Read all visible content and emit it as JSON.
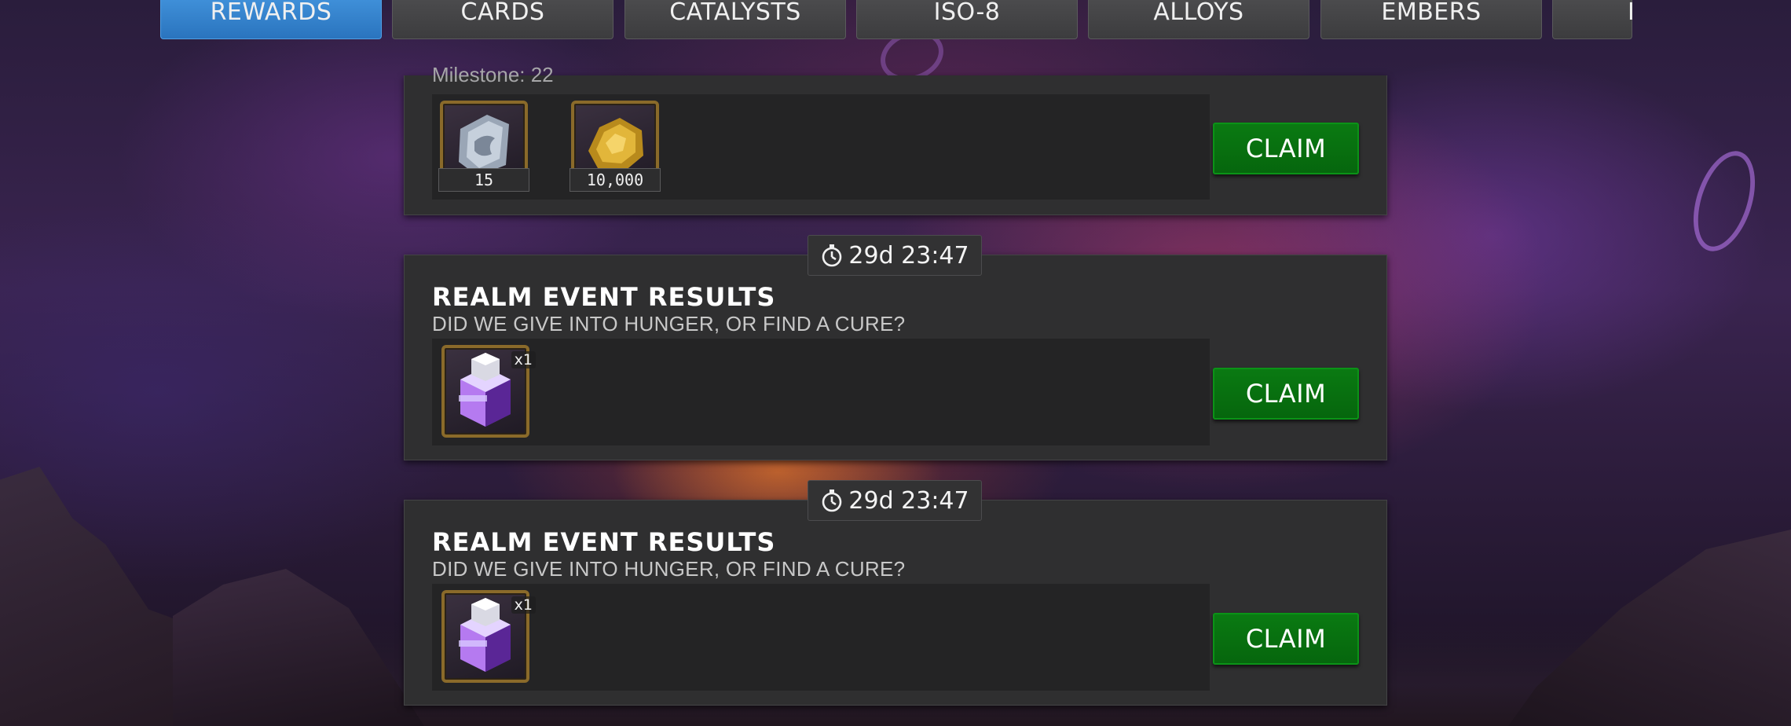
{
  "tabs": [
    {
      "label": "REWARDS",
      "active": true
    },
    {
      "label": "CARDS",
      "active": false
    },
    {
      "label": "CATALYSTS",
      "active": false
    },
    {
      "label": "ISO-8",
      "active": false
    },
    {
      "label": "ALLOYS",
      "active": false
    },
    {
      "label": "EMBERS",
      "active": false
    },
    {
      "label": "I",
      "active": false
    }
  ],
  "panels": [
    {
      "milestone": "Milestone: 22",
      "items": [
        {
          "icon": "silver-shard-icon",
          "qty": "15"
        },
        {
          "icon": "gold-icon",
          "qty": "10,000"
        }
      ],
      "claim_label": "CLAIM"
    },
    {
      "timer": "29d 23:47",
      "title": "REALM EVENT RESULTS",
      "subtitle": "DID WE GIVE INTO HUNGER, OR FIND A CURE?",
      "items": [
        {
          "icon": "crystal-icon",
          "mult": "x1"
        }
      ],
      "claim_label": "CLAIM"
    },
    {
      "timer": "29d 23:47",
      "title": "REALM EVENT RESULTS",
      "subtitle": "DID WE GIVE INTO HUNGER, OR FIND A CURE?",
      "items": [
        {
          "icon": "crystal-icon",
          "mult": "x1"
        }
      ],
      "claim_label": "CLAIM"
    }
  ],
  "colors": {
    "active_tab": "#2f80cc",
    "claim_button": "#077a10",
    "panel": "#2f2f30"
  }
}
